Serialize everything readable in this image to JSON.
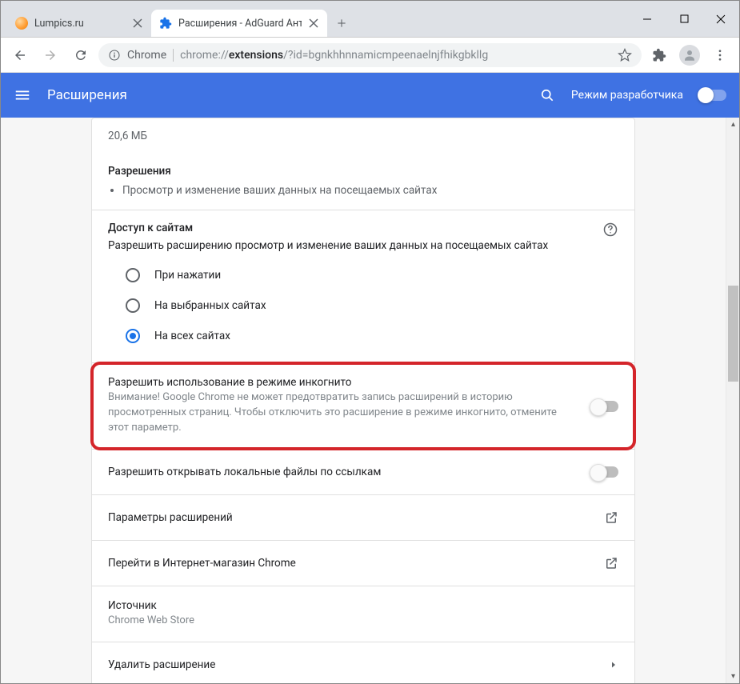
{
  "window": {
    "minimize_title": "Свернуть",
    "maximize_title": "Развернуть",
    "close_title": "Закрыть"
  },
  "tabs": [
    {
      "title": "Lumpics.ru",
      "active": false
    },
    {
      "title": "Расширения - AdGuard Антиба",
      "active": true
    }
  ],
  "omnibox": {
    "secure_icon_label": "Chrome",
    "chrome_label": "Chrome",
    "url_prefix": "chrome://",
    "url_bold": "extensions",
    "url_suffix": "/?id=bgnkhhnnamicmpeenaelnjfhikgbkllg"
  },
  "ext_header": {
    "title": "Расширения",
    "devmode_label": "Режим разработчика"
  },
  "details": {
    "size_value": "20,6 МБ",
    "permissions_title": "Разрешения",
    "permissions_items": [
      "Просмотр и изменение ваших данных на посещаемых сайтах"
    ],
    "site_access_title": "Доступ к сайтам",
    "site_access_desc": "Разрешить расширению просмотр и изменение ваших данных на посещаемых сайтах",
    "radios": [
      {
        "label": "При нажатии",
        "checked": false
      },
      {
        "label": "На выбранных сайтах",
        "checked": false
      },
      {
        "label": "На всех сайтах",
        "checked": true
      }
    ],
    "incognito_title": "Разрешить использование в режиме инкогнито",
    "incognito_warning": "Внимание! Google Chrome не может предотвратить запись расширений в историю просмотренных страниц. Чтобы отключить это расширение в режиме инкогнито, отмените этот параметр.",
    "allow_file_urls": "Разрешить открывать локальные файлы по ссылкам",
    "extension_options": "Параметры расширений",
    "open_in_store": "Перейти в Интернет-магазин Chrome",
    "source_title": "Источник",
    "source_value": "Chrome Web Store",
    "remove_extension": "Удалить расширение"
  }
}
